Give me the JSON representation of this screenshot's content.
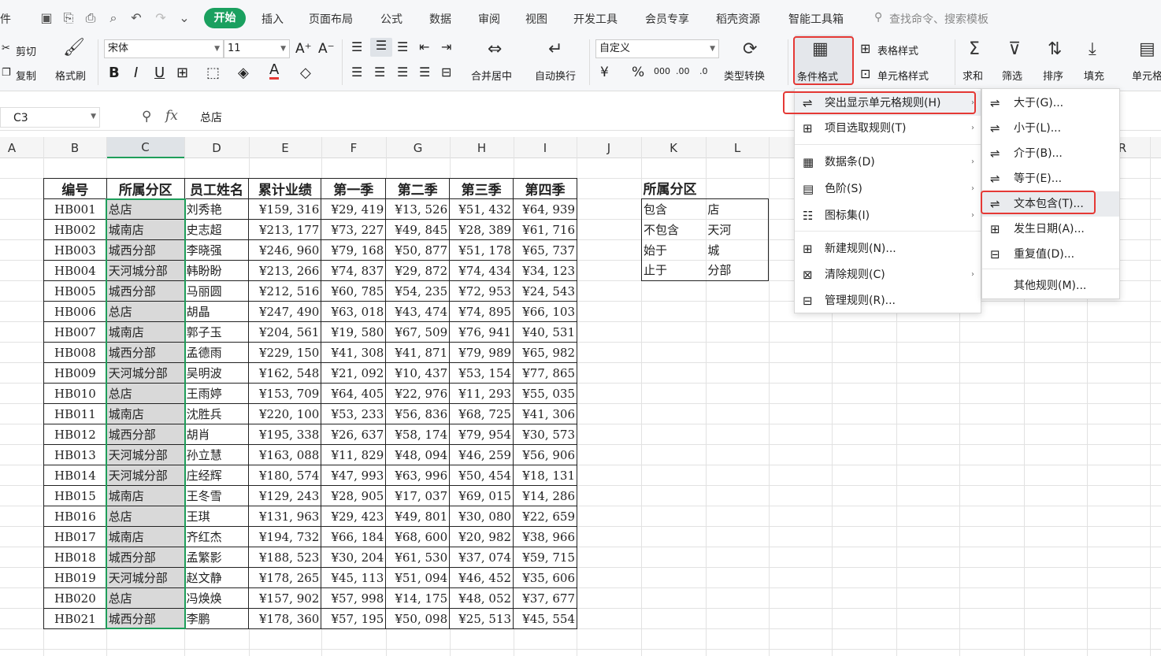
{
  "menubar": {
    "file": "件",
    "qa_more": "⌄",
    "tabs": [
      "开始",
      "插入",
      "页面布局",
      "公式",
      "数据",
      "审阅",
      "视图",
      "开发工具",
      "会员专享",
      "稻壳资源",
      "智能工具箱"
    ],
    "search": "查找命令、搜索模板"
  },
  "ribbon": {
    "cut": "剪切",
    "copy": "复制",
    "format_painter": "格式刷",
    "font": "宋体",
    "size": "11",
    "merge": "合并居中",
    "wrap": "自动换行",
    "numfmt": "自定义",
    "type_convert": "类型转换",
    "cond_format": "条件格式",
    "table_style": "表格样式",
    "cell_style": "单元格样式",
    "sum": "求和",
    "filter": "筛选",
    "sort": "排序",
    "fill": "填充",
    "cell": "单元格",
    "bold": "B",
    "italic": "I",
    "underline": "U",
    "font_grow": "A⁺",
    "font_shrink": "A⁻",
    "yen": "¥",
    "percent": "%",
    "thousands": "000",
    "dec_inc": ".00",
    "dec_dec": ".0"
  },
  "formula": {
    "cellref": "C3",
    "fx": "fx",
    "value": "总店"
  },
  "columns": [
    "A",
    "B",
    "C",
    "D",
    "E",
    "F",
    "G",
    "H",
    "I",
    "J",
    "K",
    "L",
    "R"
  ],
  "main_table": {
    "headers": [
      "编号",
      "所属分区",
      "员工姓名",
      "累计业绩",
      "第一季",
      "第二季",
      "第三季",
      "第四季"
    ],
    "rows": [
      [
        "HB001",
        "总店",
        "刘秀艳",
        "¥159, 316",
        "¥29, 419",
        "¥13, 526",
        "¥51, 432",
        "¥64, 939"
      ],
      [
        "HB002",
        "城南店",
        "史志超",
        "¥213, 177",
        "¥73, 227",
        "¥49, 845",
        "¥28, 389",
        "¥61, 716"
      ],
      [
        "HB003",
        "城西分部",
        "李晓强",
        "¥246, 960",
        "¥79, 168",
        "¥50, 877",
        "¥51, 178",
        "¥65, 737"
      ],
      [
        "HB004",
        "天河城分部",
        "韩盼盼",
        "¥213, 266",
        "¥74, 837",
        "¥29, 872",
        "¥74, 434",
        "¥34, 123"
      ],
      [
        "HB005",
        "城西分部",
        "马丽圆",
        "¥212, 516",
        "¥60, 785",
        "¥54, 235",
        "¥72, 953",
        "¥24, 543"
      ],
      [
        "HB006",
        "总店",
        "胡晶",
        "¥247, 490",
        "¥63, 018",
        "¥43, 474",
        "¥74, 895",
        "¥66, 103"
      ],
      [
        "HB007",
        "城南店",
        "郭子玉",
        "¥204, 561",
        "¥19, 580",
        "¥67, 509",
        "¥76, 941",
        "¥40, 531"
      ],
      [
        "HB008",
        "城西分部",
        "孟德雨",
        "¥229, 150",
        "¥41, 308",
        "¥41, 871",
        "¥79, 989",
        "¥65, 982"
      ],
      [
        "HB009",
        "天河城分部",
        "吴明波",
        "¥162, 548",
        "¥21, 092",
        "¥10, 437",
        "¥53, 154",
        "¥77, 865"
      ],
      [
        "HB010",
        "总店",
        "王雨婷",
        "¥153, 709",
        "¥64, 405",
        "¥22, 976",
        "¥11, 293",
        "¥55, 035"
      ],
      [
        "HB011",
        "城南店",
        "沈胜兵",
        "¥220, 100",
        "¥53, 233",
        "¥56, 836",
        "¥68, 725",
        "¥41, 306"
      ],
      [
        "HB012",
        "城西分部",
        "胡肖",
        "¥195, 338",
        "¥26, 637",
        "¥58, 174",
        "¥79, 954",
        "¥30, 573"
      ],
      [
        "HB013",
        "天河城分部",
        "孙立慧",
        "¥163, 088",
        "¥11, 829",
        "¥48, 094",
        "¥46, 259",
        "¥56, 906"
      ],
      [
        "HB014",
        "天河城分部",
        "庄经辉",
        "¥180, 574",
        "¥47, 993",
        "¥63, 996",
        "¥50, 454",
        "¥18, 131"
      ],
      [
        "HB015",
        "城南店",
        "王冬雪",
        "¥129, 243",
        "¥28, 905",
        "¥17, 037",
        "¥69, 015",
        "¥14, 286"
      ],
      [
        "HB016",
        "总店",
        "王琪",
        "¥131, 963",
        "¥29, 423",
        "¥49, 801",
        "¥30, 080",
        "¥22, 659"
      ],
      [
        "HB017",
        "城南店",
        "齐红杰",
        "¥194, 732",
        "¥66, 184",
        "¥68, 600",
        "¥20, 982",
        "¥38, 966"
      ],
      [
        "HB018",
        "城西分部",
        "孟繁影",
        "¥188, 523",
        "¥30, 204",
        "¥61, 530",
        "¥37, 074",
        "¥59, 715"
      ],
      [
        "HB019",
        "天河城分部",
        "赵文静",
        "¥178, 265",
        "¥45, 113",
        "¥51, 094",
        "¥46, 452",
        "¥35, 606"
      ],
      [
        "HB020",
        "总店",
        "冯焕焕",
        "¥157, 902",
        "¥57, 998",
        "¥14, 175",
        "¥48, 052",
        "¥37, 677"
      ],
      [
        "HB021",
        "城西分部",
        "李鹏",
        "¥178, 360",
        "¥57, 195",
        "¥50, 098",
        "¥25, 513",
        "¥45, 554"
      ]
    ]
  },
  "side_table": {
    "header": "所属分区",
    "rows": [
      [
        "包含",
        "店"
      ],
      [
        "不包含",
        "天河"
      ],
      [
        "始于",
        "城"
      ],
      [
        "止于",
        "分部"
      ]
    ]
  },
  "cf_menu": [
    "突出显示单元格规则(H)",
    "项目选取规则(T)",
    "数据条(D)",
    "色阶(S)",
    "图标集(I)",
    "新建规则(N)...",
    "清除规则(C)",
    "管理规则(R)..."
  ],
  "sub_menu": [
    "大于(G)...",
    "小于(L)...",
    "介于(B)...",
    "等于(E)...",
    "文本包含(T)...",
    "发生日期(A)...",
    "重复值(D)...",
    "其他规则(M)..."
  ],
  "colors": {
    "accent": "#1aa05f",
    "highlight_red": "#e53935",
    "selection": "#1e9e5a"
  }
}
